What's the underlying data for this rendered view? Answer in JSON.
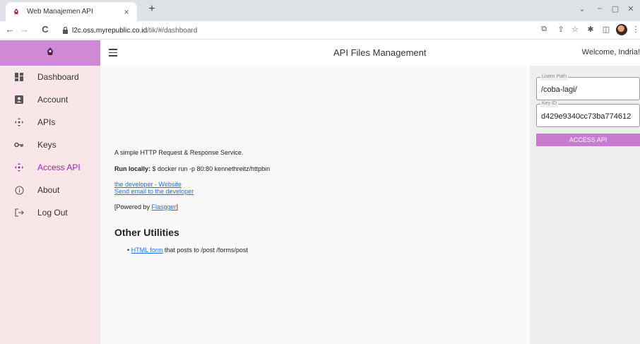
{
  "browser": {
    "tab_title": "Web Manajemen API",
    "tab_close": "×",
    "new_tab": "+",
    "url_host": "l2c.oss.myrepublic.co.id",
    "url_path": "/tik/#/dashboard",
    "back": "←",
    "forward": "→",
    "reload": "C",
    "win_min": "–",
    "win_max": "▢",
    "win_close": "✕",
    "win_chevron": "⌄"
  },
  "header": {
    "title": "API Files Management",
    "welcome": "Welcome, Indria!"
  },
  "sidebar": {
    "items": [
      {
        "label": "Dashboard",
        "icon": "dashboard-icon"
      },
      {
        "label": "Account",
        "icon": "account-icon"
      },
      {
        "label": "APIs",
        "icon": "apis-icon"
      },
      {
        "label": "Keys",
        "icon": "key-icon"
      },
      {
        "label": "Access API",
        "icon": "access-api-icon",
        "active": true
      },
      {
        "label": "About",
        "icon": "info-icon"
      },
      {
        "label": "Log Out",
        "icon": "logout-icon"
      }
    ]
  },
  "main": {
    "description": "A simple HTTP Request & Response Service.",
    "run_label": "Run locally:",
    "run_cmd": " $ docker run -p 80:80 kennethreitz/httpbin",
    "dev_website": "the developer - Website",
    "dev_email": "Send email to the developer",
    "powered_prefix": "[Powered by ",
    "powered_link": "Flasgger",
    "powered_suffix": "]",
    "utilities_heading": "Other Utilities",
    "util_link": "HTML form",
    "util_text": " that posts to /post /forms/post"
  },
  "panel": {
    "listen_label": "Listen Path",
    "listen_value": "/coba-lagi/",
    "key_label": "Key ID",
    "key_value": "d429e9340cc73ba774612",
    "access_button": "ACCESS API"
  },
  "colors": {
    "accent": "#cf8ad6",
    "active": "#9c27b0",
    "button": "#c77bd1",
    "sidebar_bg": "#f8e6e8",
    "link": "#1a73e8"
  }
}
